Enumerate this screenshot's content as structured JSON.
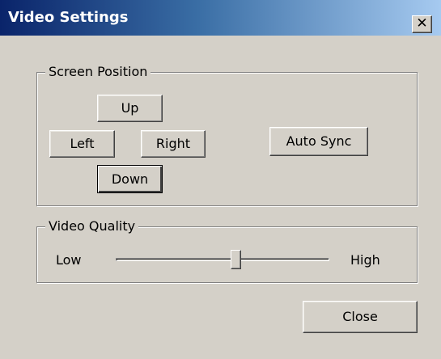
{
  "window": {
    "title": "Video Settings",
    "close_glyph": "✕",
    "close_icon": "close-icon"
  },
  "screen_position": {
    "label": "Screen Position",
    "up_label": "Up",
    "left_label": "Left",
    "right_label": "Right",
    "down_label": "Down",
    "auto_sync_label": "Auto Sync"
  },
  "video_quality": {
    "label": "Video Quality",
    "low_label": "Low",
    "high_label": "High",
    "slider_level": 0.56
  },
  "footer": {
    "close_label": "Close"
  },
  "colors": {
    "dialog_face": "#d4d0c8",
    "title_gradient_start": "#0a246a",
    "title_gradient_end": "#a6caf0",
    "title_text": "#ffffff"
  }
}
